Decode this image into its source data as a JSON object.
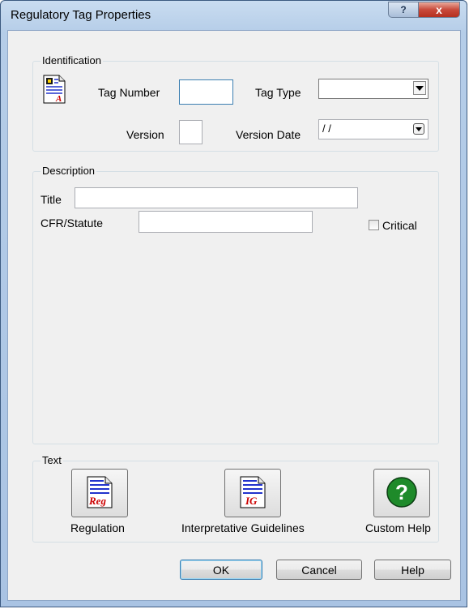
{
  "window": {
    "title": "Regulatory Tag Properties",
    "help_glyph": "?",
    "close_glyph": "x"
  },
  "identification": {
    "legend": "Identification",
    "tag_number_label": "Tag Number",
    "tag_number_value": "",
    "tag_type_label": "Tag Type",
    "tag_type_value": "",
    "version_label": "Version",
    "version_value": "",
    "version_date_label": "Version Date",
    "version_date_value": " / /"
  },
  "description": {
    "legend": "Description",
    "title_label": "Title",
    "title_value": "",
    "cfr_label": "CFR/Statute",
    "cfr_value": "",
    "critical_label": "Critical",
    "critical_checked": false
  },
  "text_group": {
    "legend": "Text",
    "regulation_label": "Regulation",
    "regulation_icon_text": "Reg",
    "guidelines_label": "Interpretative Guidelines",
    "guidelines_icon_text": "IG",
    "custom_help_label": "Custom Help",
    "custom_help_icon_text": "?"
  },
  "buttons": {
    "ok": "OK",
    "cancel": "Cancel",
    "help": "Help"
  },
  "colors": {
    "accent_red": "#cc0000",
    "help_green": "#1e8a2a",
    "doc_blue": "#2233cc"
  }
}
